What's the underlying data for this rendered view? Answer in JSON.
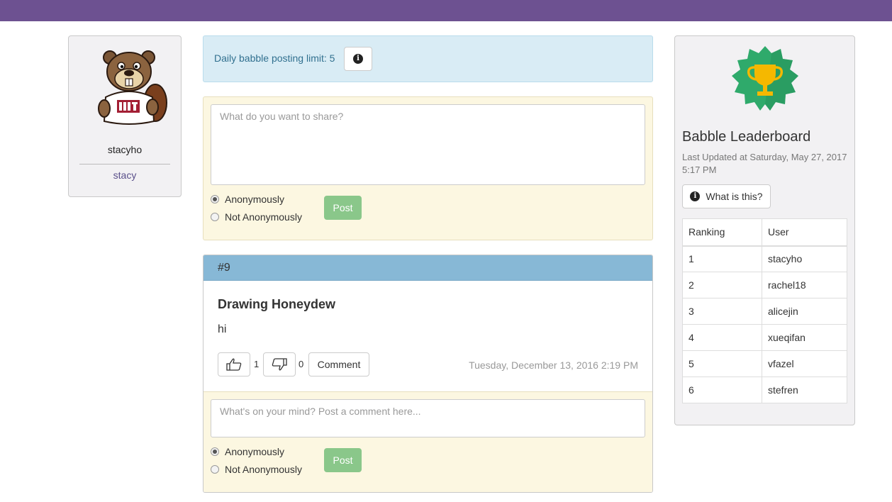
{
  "colors": {
    "topbar": "#6d5191",
    "info_bg": "#d9ecf5",
    "compose_bg": "#fcf7e1",
    "post_header": "#87b8d6",
    "post_button": "#8ac78a",
    "trophy_badge": "#2faa6b"
  },
  "profile": {
    "username": "stacyho",
    "nickname": "stacy",
    "avatar_icon": "beaver-mascot-icon"
  },
  "limit": {
    "text": "Daily babble posting limit: 5",
    "info_icon": "info-icon"
  },
  "compose": {
    "placeholder": "What do you want to share?",
    "options": [
      "Anonymously",
      "Not Anonymously"
    ],
    "selected": "Anonymously",
    "post_label": "Post"
  },
  "post": {
    "number": "#9",
    "title": "Drawing Honeydew",
    "body": "hi",
    "likes": "1",
    "dislikes": "0",
    "comment_label": "Comment",
    "date": "Tuesday, December 13, 2016 2:19 PM",
    "comment_placeholder": "What's on your mind? Post a comment here...",
    "comment_options": [
      "Anonymously",
      "Not Anonymously"
    ],
    "comment_post_label": "Post"
  },
  "leaderboard": {
    "title": "Babble Leaderboard",
    "updated": "Last Updated at Saturday, May 27, 2017 5:17 PM",
    "what_label": "What is this?",
    "columns": [
      "Ranking",
      "User"
    ],
    "rows": [
      [
        "1",
        "stacyho"
      ],
      [
        "2",
        "rachel18"
      ],
      [
        "3",
        "alicejin"
      ],
      [
        "4",
        "xueqifan"
      ],
      [
        "5",
        "vfazel"
      ],
      [
        "6",
        "stefren"
      ]
    ]
  }
}
